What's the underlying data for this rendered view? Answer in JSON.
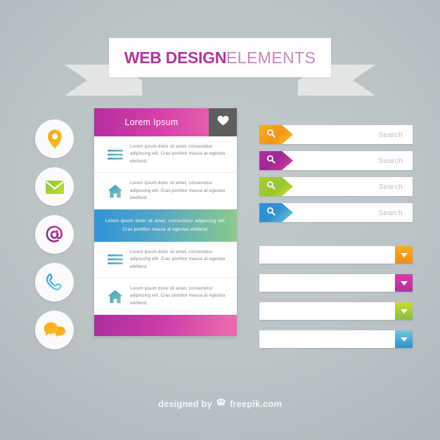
{
  "banner": {
    "title_strong": "WEB DESIGN",
    "title_light": "ELEMENTS",
    "strong_color": "#b0369b",
    "light_color": "#c489bd"
  },
  "icon_column": {
    "items": [
      {
        "name": "location-pin-icon",
        "label": "Location",
        "color_from": "#f9a11b",
        "color_to": "#f4c01f"
      },
      {
        "name": "envelope-icon",
        "label": "Email",
        "color_from": "#8cc63f",
        "color_to": "#c4d92e"
      },
      {
        "name": "at-sign-icon",
        "label": "Mention",
        "color_from": "#8e2f8e",
        "color_to": "#c0399b"
      },
      {
        "name": "phone-icon",
        "label": "Phone",
        "color_from": "#2e9ed6",
        "color_to": "#6ec9d8"
      },
      {
        "name": "chat-bubbles-icon",
        "label": "Chat",
        "color_from": "#f6a01a",
        "color_to": "#fbbf2a"
      }
    ]
  },
  "list_card": {
    "header": {
      "title": "Lorem Ipsum",
      "fav_icon": "heart-icon",
      "gradient_from": "#b52ea0",
      "gradient_to": "#ee6fae",
      "fav_background": "#5e5e5e"
    },
    "rows": [
      {
        "icon": "hamburger-menu-icon",
        "text": "Lorem ipsum dolor sit amet, consectetur adipiscing elit. Cras porttitor massa at egestas eleifend.",
        "highlighted": false
      },
      {
        "icon": "home-icon",
        "text": "Lorem ipsum dolor sit amet, consectetur adipiscing elit. Cras porttitor massa at egestas eleifend.",
        "highlighted": false
      },
      {
        "icon": "none",
        "text": "Lorem ipsum dolor sit amet, consectetur adipiscing elit. Cras porttitor massa at egestas eleifend.",
        "highlighted": true,
        "gradient_from": "#2f94d6",
        "gradient_to": "#8cc98b"
      },
      {
        "icon": "hamburger-menu-icon",
        "text": "Lorem ipsum dolor sit amet, consectetur adipiscing elit. Cras porttitor massa at egestas eleifend.",
        "highlighted": false
      },
      {
        "icon": "home-icon",
        "text": "Lorem ipsum dolor sit amet, consectetur adipiscing elit. Cras porttitor massa at egestas eleifend.",
        "highlighted": false
      }
    ],
    "footer": {
      "gradient_from": "#ac2e9d",
      "gradient_to": "#ec6cae"
    }
  },
  "search_bars": [
    {
      "placeholder": "Search",
      "value": "",
      "icon": "search-icon",
      "tag_from": "#f5a11c",
      "tag_to": "#f7c022"
    },
    {
      "placeholder": "Search",
      "value": "",
      "icon": "search-icon",
      "tag_from": "#9c2a93",
      "tag_to": "#d3399f"
    },
    {
      "placeholder": "Search",
      "value": "",
      "icon": "search-icon",
      "tag_from": "#9fc92c",
      "tag_to": "#c6dc30"
    },
    {
      "placeholder": "Search",
      "value": "",
      "icon": "search-icon",
      "tag_from": "#2f8fd1",
      "tag_to": "#62c3d6"
    }
  ],
  "dropdowns": [
    {
      "value": "",
      "icon": "chevron-down-icon",
      "btn_from": "#f5a41c",
      "btn_to": "#f08a1c"
    },
    {
      "value": "",
      "icon": "chevron-down-icon",
      "btn_from": "#d63ba6",
      "btn_to": "#b92f9c"
    },
    {
      "value": "",
      "icon": "chevron-down-icon",
      "btn_from": "#c3dc32",
      "btn_to": "#8cbf3f"
    },
    {
      "value": "",
      "icon": "chevron-down-icon",
      "btn_from": "#62c5d6",
      "btn_to": "#2f8fd1"
    }
  ],
  "credit": {
    "prefix": "designed by",
    "brand": "freepik.com",
    "logo_icon": "freepik-logo-icon"
  }
}
